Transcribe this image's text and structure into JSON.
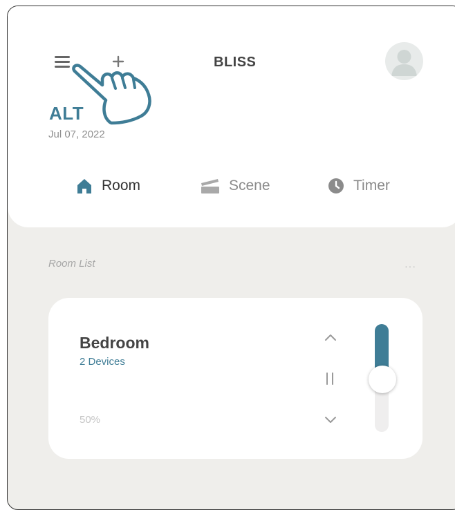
{
  "header": {
    "app_title": "BLISS",
    "device_name": "ALT",
    "date": "Jul 07, 2022"
  },
  "tabs": [
    {
      "label": "Room",
      "icon": "home-icon",
      "active": true
    },
    {
      "label": "Scene",
      "icon": "scene-icon",
      "active": false
    },
    {
      "label": "Timer",
      "icon": "clock-icon",
      "active": false
    }
  ],
  "room_list": {
    "label": "Room List",
    "more": "···",
    "rooms": [
      {
        "name": "Bedroom",
        "devices": "2 Devices",
        "level_text": "50%",
        "slider_level": 0.45
      }
    ]
  },
  "colors": {
    "accent": "#3f7d96",
    "background": "#efeeeb",
    "card": "#ffffff"
  },
  "icons": [
    "menu-icon",
    "plus-icon",
    "avatar-icon",
    "hand-pointer-icon",
    "chevron-up-icon",
    "pause-icon",
    "chevron-down-icon",
    "more-icon"
  ]
}
